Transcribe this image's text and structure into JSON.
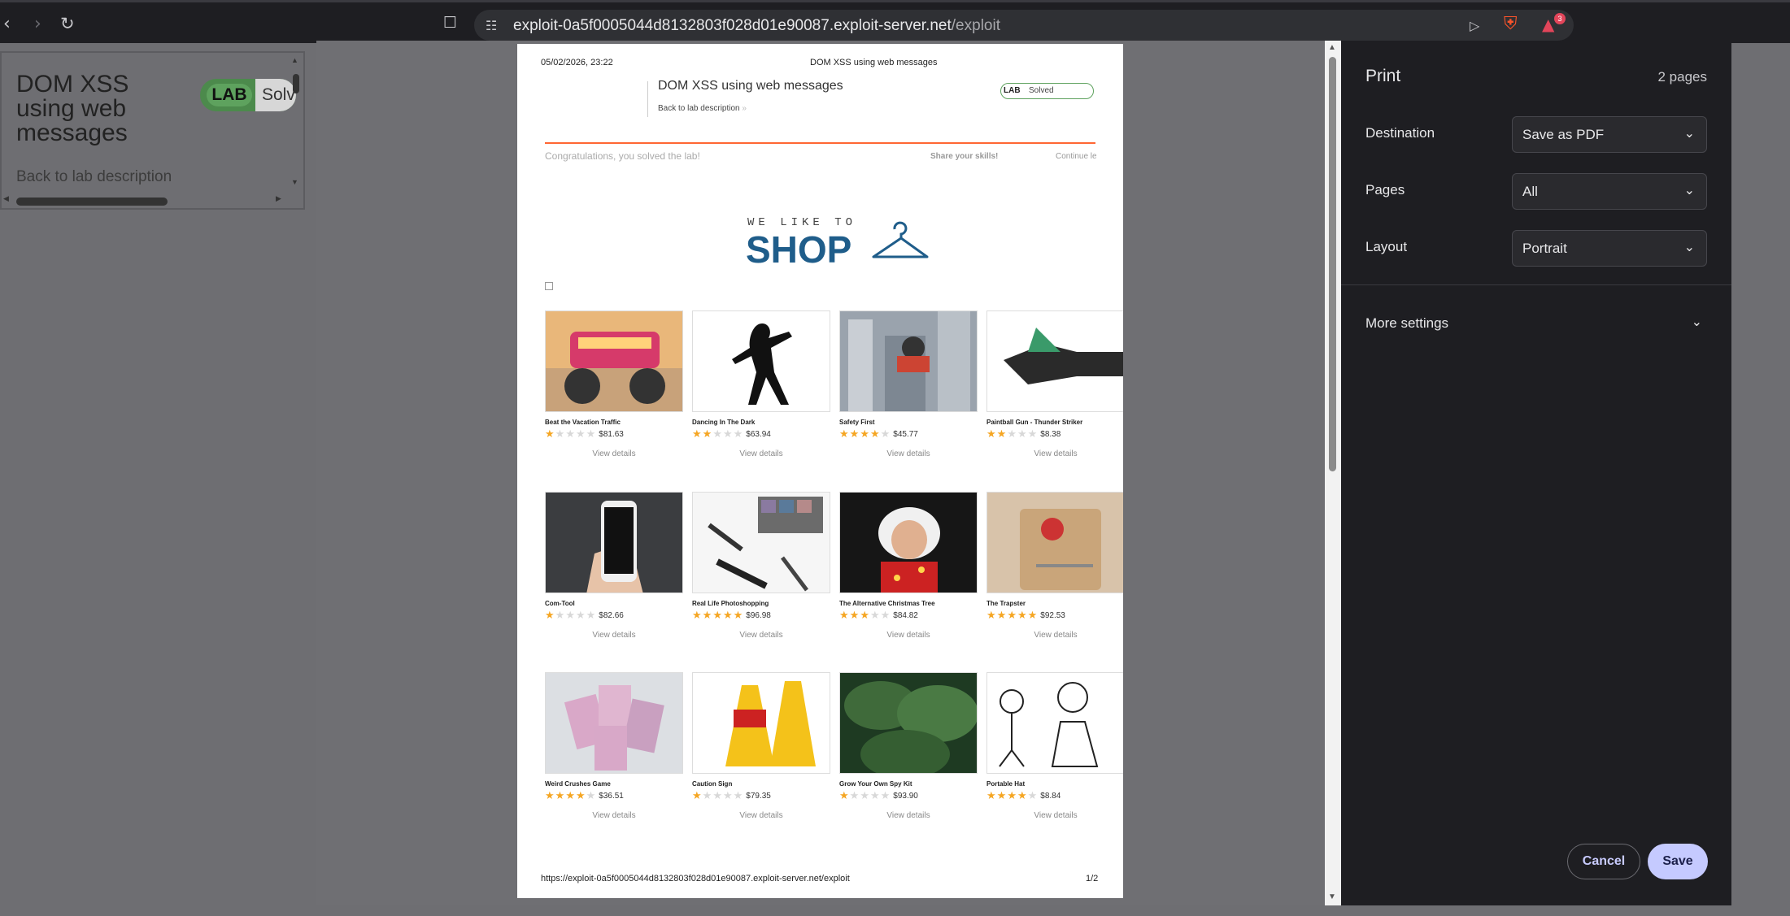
{
  "browser": {
    "url_host": "exploit-0a5f0005044d8132803f028d01e90087.exploit-server.net",
    "url_path": "/exploit",
    "notification_count": "3"
  },
  "left_panel": {
    "title": "DOM XSS using web messages",
    "lab_badge": "LAB",
    "status_text": "Solv",
    "back_link": "Back to lab description"
  },
  "preview": {
    "header_date": "05/02/2026, 23:22",
    "header_title": "DOM XSS using web messages",
    "banner_title": "DOM XSS using web messages",
    "back_link": "Back to lab description",
    "lab_badge": "LAB",
    "solved_label": "Solved",
    "congrats": "Congratulations, you solved the lab!",
    "share": "Share your skills!",
    "continue": "Continue le",
    "logo_small": "WE LIKE TO",
    "logo_big": "SHOP",
    "view_details": "View details",
    "footer_url": "https://exploit-0a5f0005044d8132803f028d01e90087.exploit-server.net/exploit",
    "footer_page": "1/2",
    "products": [
      {
        "name": "Beat the Vacation Traffic",
        "price": "$81.63",
        "rating": 1
      },
      {
        "name": "Dancing In The Dark",
        "price": "$63.94",
        "rating": 2
      },
      {
        "name": "Safety First",
        "price": "$45.77",
        "rating": 4
      },
      {
        "name": "Paintball Gun - Thunder Striker",
        "price": "$8.38",
        "rating": 2
      },
      {
        "name": "Com-Tool",
        "price": "$82.66",
        "rating": 1
      },
      {
        "name": "Real Life Photoshopping",
        "price": "$96.98",
        "rating": 5
      },
      {
        "name": "The Alternative Christmas Tree",
        "price": "$84.82",
        "rating": 3
      },
      {
        "name": "The Trapster",
        "price": "$92.53",
        "rating": 5
      },
      {
        "name": "Weird Crushes Game",
        "price": "$36.51",
        "rating": 4
      },
      {
        "name": "Caution Sign",
        "price": "$79.35",
        "rating": 1
      },
      {
        "name": "Grow Your Own Spy Kit",
        "price": "$93.90",
        "rating": 1
      },
      {
        "name": "Portable Hat",
        "price": "$8.84",
        "rating": 4
      }
    ]
  },
  "print": {
    "title": "Print",
    "page_count": "2 pages",
    "destination_label": "Destination",
    "destination_value": "Save as PDF",
    "pages_label": "Pages",
    "pages_value": "All",
    "layout_label": "Layout",
    "layout_value": "Portrait",
    "more_settings": "More settings",
    "cancel": "Cancel",
    "save": "Save"
  }
}
